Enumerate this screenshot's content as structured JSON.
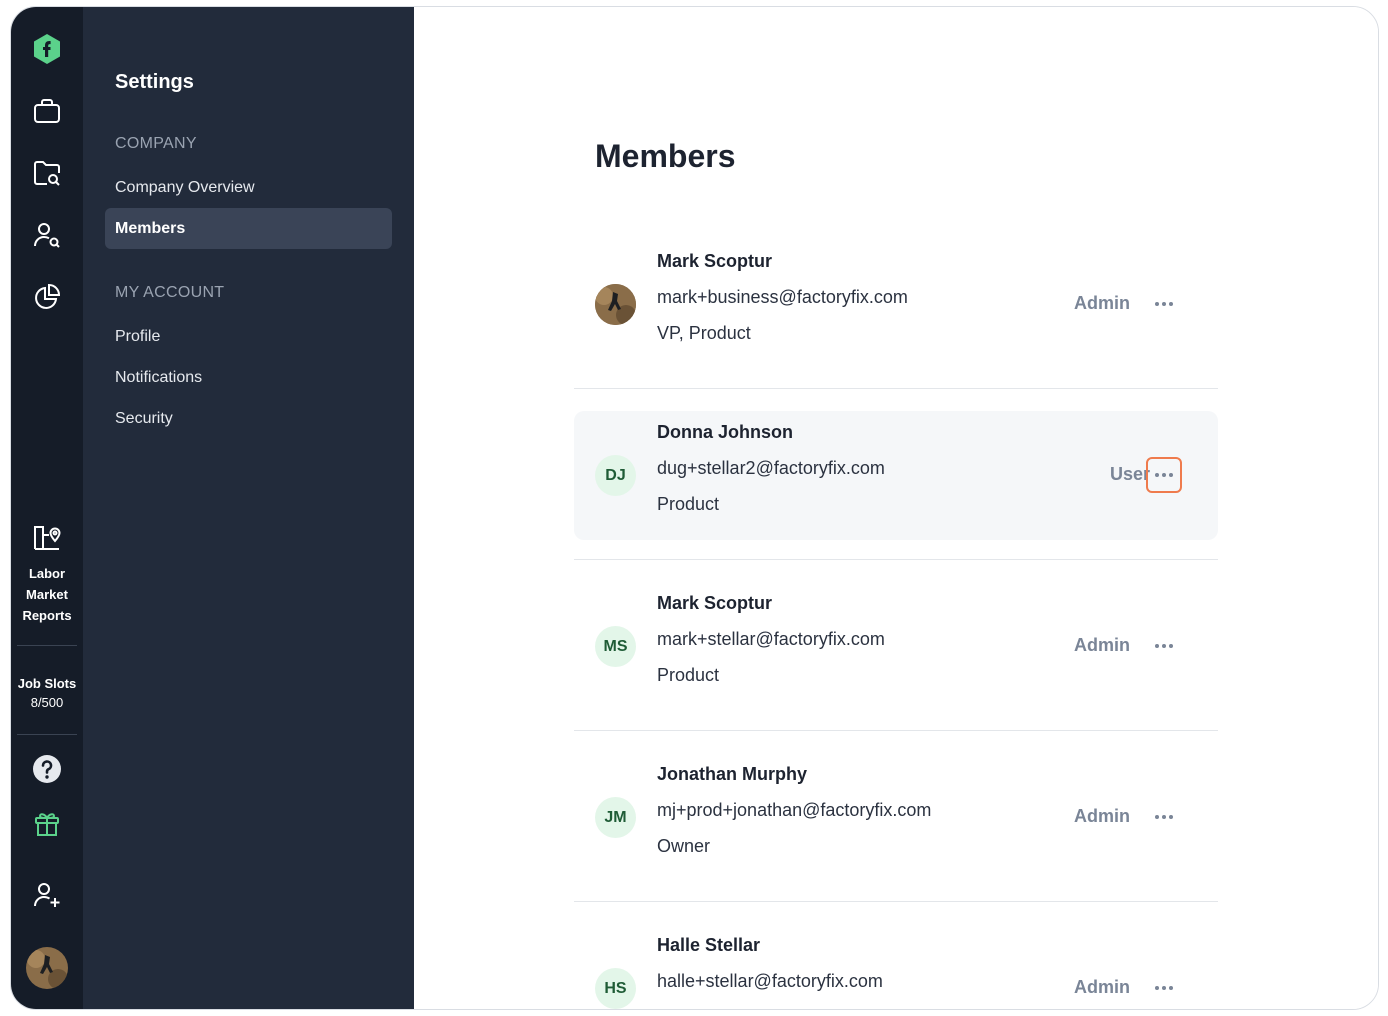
{
  "rail": {
    "labor_market_reports": [
      "Labor",
      "Market",
      "Reports"
    ],
    "job_slots_label": "Job Slots",
    "job_slots_value": "8/500",
    "brand_color": "#5bd28b"
  },
  "sidebar": {
    "title": "Settings",
    "section_company": "COMPANY",
    "company_items": [
      {
        "label": "Company Overview"
      },
      {
        "label": "Members"
      }
    ],
    "section_account": "MY ACCOUNT",
    "account_items": [
      {
        "label": "Profile"
      },
      {
        "label": "Notifications"
      },
      {
        "label": "Security"
      }
    ]
  },
  "main": {
    "title": "Members",
    "members": [
      {
        "name": "Mark Scoptur",
        "email": "mark+business@factoryfix.com",
        "role": "VP, Product",
        "permission": "Admin",
        "initials": "",
        "photo": true
      },
      {
        "name": "Donna Johnson",
        "email": "dug+stellar2@factoryfix.com",
        "role": "Product",
        "permission": "User",
        "initials": "DJ",
        "photo": false
      },
      {
        "name": "Mark Scoptur",
        "email": "mark+stellar@factoryfix.com",
        "role": "Product",
        "permission": "Admin",
        "initials": "MS",
        "photo": false
      },
      {
        "name": "Jonathan Murphy",
        "email": "mj+prod+jonathan@factoryfix.com",
        "role": "Owner",
        "permission": "Admin",
        "initials": "JM",
        "photo": false
      },
      {
        "name": "Halle Stellar",
        "email": "halle+stellar@factoryfix.com",
        "role": "",
        "permission": "Admin",
        "initials": "HS",
        "photo": false
      }
    ]
  }
}
